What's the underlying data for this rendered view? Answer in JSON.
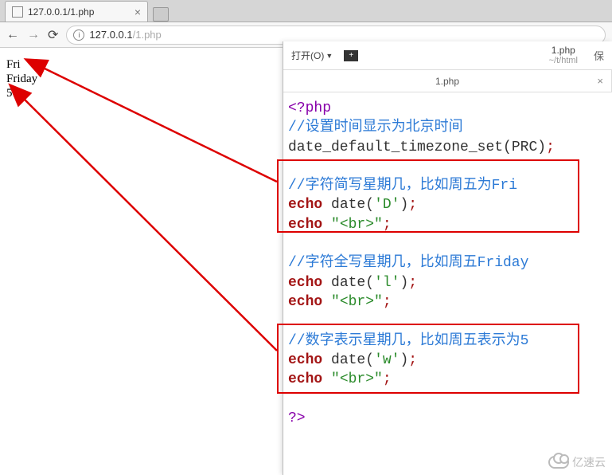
{
  "browser": {
    "tab_title": "127.0.0.1/1.php",
    "url_host": "127.0.0.1",
    "url_path": "/1.php"
  },
  "page_output": {
    "line1": "Fri",
    "line2": "Friday",
    "line3": "5"
  },
  "editor": {
    "open_label": "打开(O)",
    "file_name": "1.php",
    "file_path": "~/t/html",
    "tab_label": "1.php",
    "code": {
      "l1_open": "<?php",
      "l2_comment": "//设置时间显示为北京时间",
      "l3_func": "date_default_timezone_set",
      "l3_arg": "PRC",
      "l5_comment": "//字符简写星期几，比如周五为Fri",
      "l6_kw": "echo",
      "l6_func": "date",
      "l6_arg": "'D'",
      "l7_kw": "echo",
      "l7_str": "\"<br>\"",
      "l9_comment": "//字符全写星期几，比如周五Friday",
      "l10_kw": "echo",
      "l10_func": "date",
      "l10_arg": "'l'",
      "l11_kw": "echo",
      "l11_str": "\"<br>\"",
      "l13_comment": "//数字表示星期几，比如周五表示为5",
      "l14_kw": "echo",
      "l14_func": "date",
      "l14_arg": "'w'",
      "l15_kw": "echo",
      "l15_str": "\"<br>\"",
      "l17_close": "?>"
    }
  },
  "watermark": "亿速云"
}
